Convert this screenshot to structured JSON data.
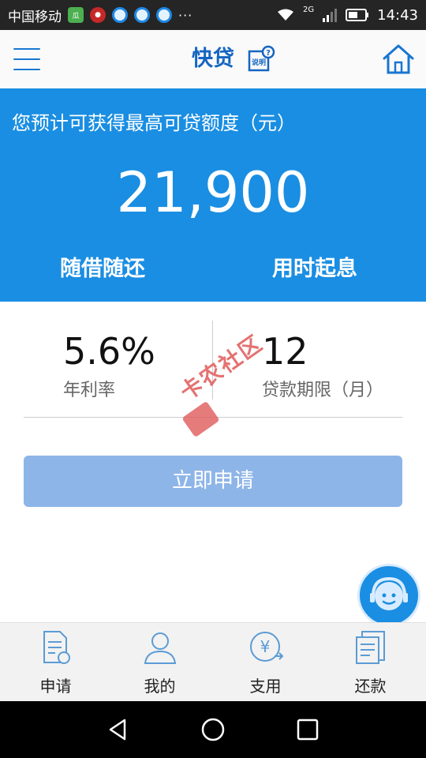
{
  "status_bar": {
    "carrier": "中国移动",
    "network": "2G",
    "time": "14:43",
    "overflow": "···",
    "app_icons": [
      "melon-app-icon",
      "red-app-icon",
      "q-app-icon",
      "q-app-icon",
      "q-app-icon"
    ]
  },
  "header": {
    "title": "快贷",
    "help_label": "说明"
  },
  "banner": {
    "label": "您预计可获得最高可贷额度（元）",
    "amount": "21,900",
    "feature_left": "随借随还",
    "feature_right": "用时起息"
  },
  "stats": {
    "rate_value": "5.6%",
    "rate_label": "年利率",
    "term_value": "12",
    "term_label": "贷款期限（月）"
  },
  "watermark": {
    "text": "卡农社区"
  },
  "apply_button": {
    "label": "立即申请"
  },
  "bottom_nav": [
    {
      "label": "申请",
      "icon": "apply-document-icon"
    },
    {
      "label": "我的",
      "icon": "user-profile-icon"
    },
    {
      "label": "支用",
      "icon": "yuan-withdraw-icon"
    },
    {
      "label": "还款",
      "icon": "repay-document-icon"
    }
  ],
  "colors": {
    "banner_bg": "#1a8ee2",
    "title_blue": "#1565c0",
    "button_bg": "#8eb5e8"
  }
}
